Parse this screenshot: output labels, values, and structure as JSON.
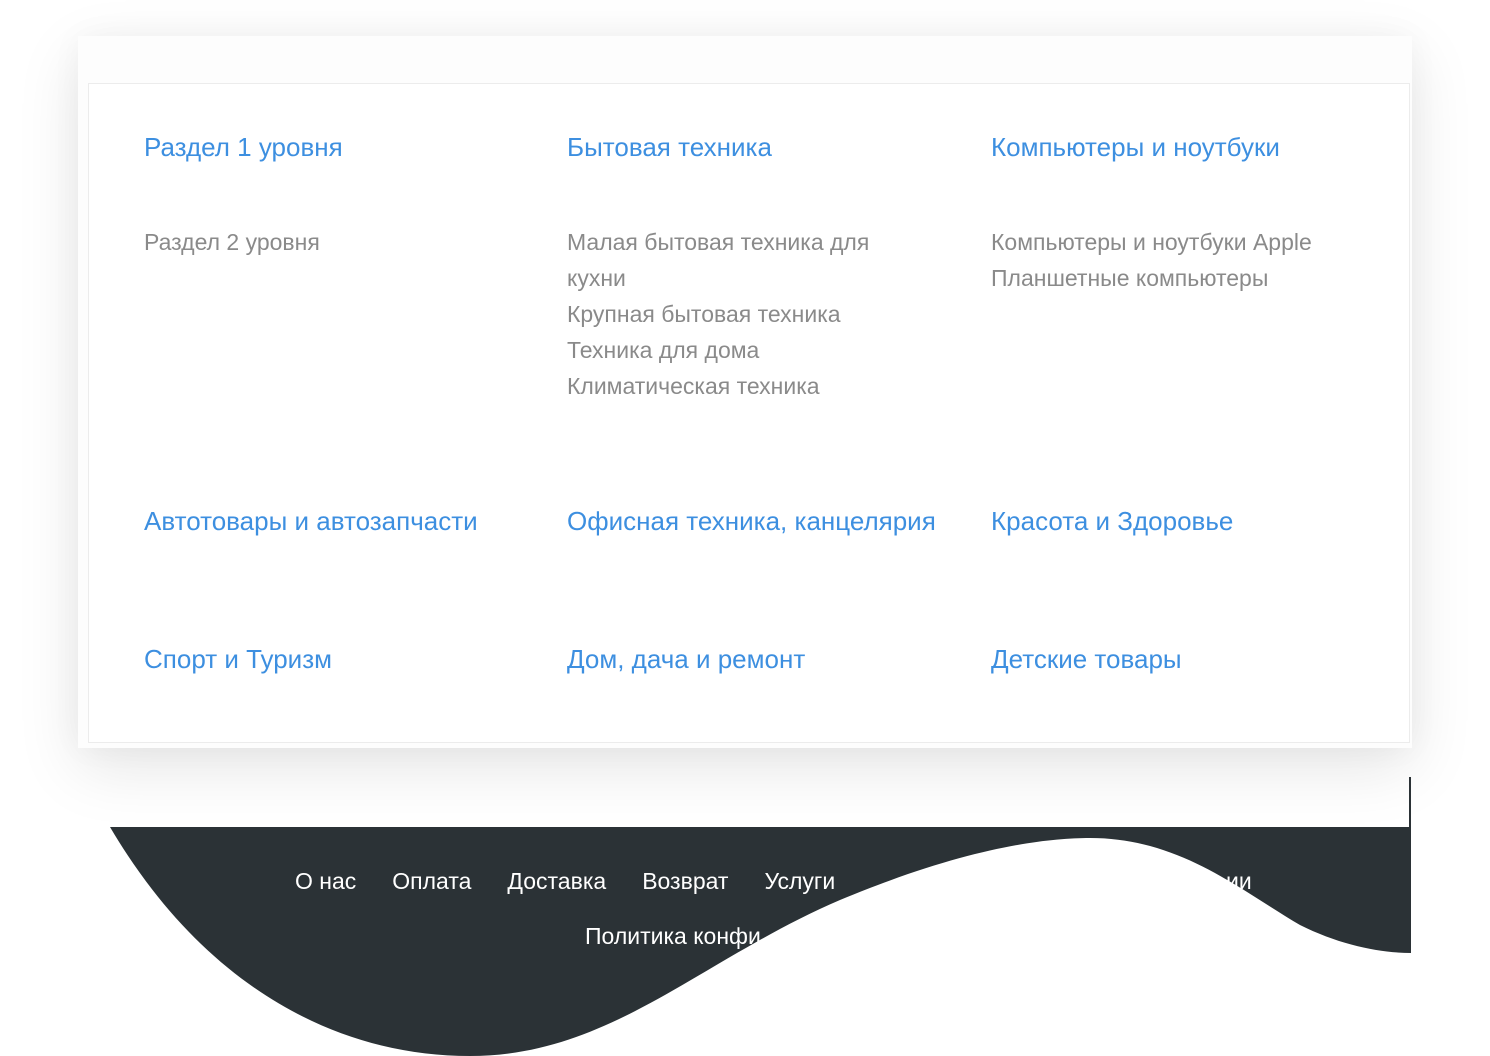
{
  "categories": [
    {
      "title": "Раздел 1 уровня",
      "items": [
        "Раздел 2 уровня"
      ]
    },
    {
      "title": "Бытовая техника",
      "items": [
        "Малая бытовая техника для кухни",
        "Крупная бытовая техника",
        "Техника для дома",
        "Климатическая техника"
      ]
    },
    {
      "title": "Компьютеры и ноутбуки",
      "items": [
        "Компьютеры и ноутбуки Apple",
        "Планшетные компьютеры"
      ]
    },
    {
      "title": "Автотовары и автозапчасти",
      "items": []
    },
    {
      "title": "Офисная техника, канцелярия",
      "items": []
    },
    {
      "title": "Красота и Здоровье",
      "items": []
    },
    {
      "title": "Спорт и Туризм",
      "items": []
    },
    {
      "title": "Дом, дача и ремонт",
      "items": []
    },
    {
      "title": "Детские товары",
      "items": []
    }
  ],
  "footer": {
    "links": [
      "О нас",
      "Оплата",
      "Доставка",
      "Возврат",
      "Услуги"
    ],
    "partial_link_tail": "ии",
    "second_row": "Политика конфи"
  },
  "colors": {
    "link": "#3d8fe0",
    "subitem": "#8a8a8a",
    "footer_bg": "#2b3236",
    "footer_text": "#ffffff"
  }
}
